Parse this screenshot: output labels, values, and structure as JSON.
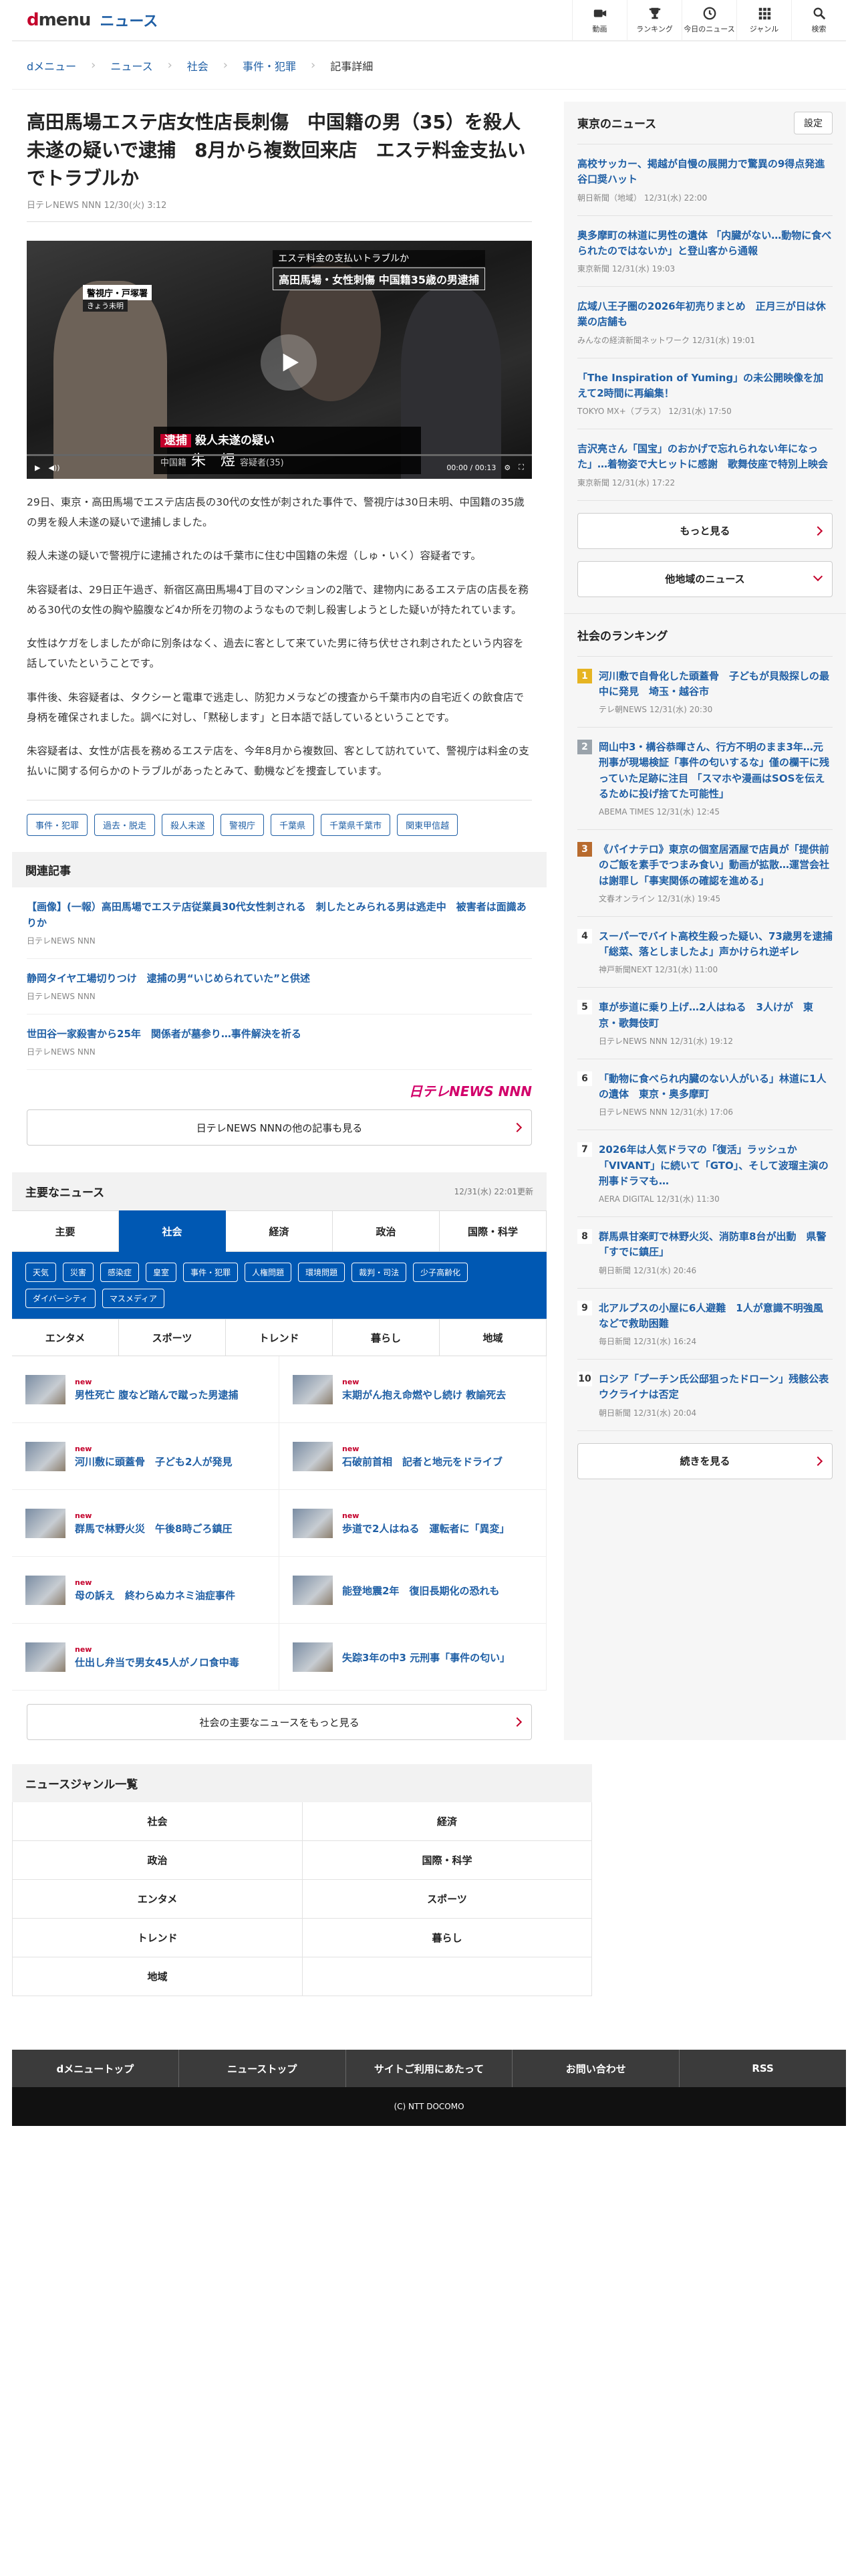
{
  "header": {
    "logo_d": "d",
    "logo_menu": "menu",
    "logo_news": "ニュース",
    "nav": [
      {
        "icon": "video-icon",
        "label": "動画"
      },
      {
        "icon": "trophy-icon",
        "label": "ランキング"
      },
      {
        "icon": "clock-icon",
        "label": "今日のニュース"
      },
      {
        "icon": "grid-icon",
        "label": "ジャンル"
      },
      {
        "icon": "search-icon",
        "label": "検索"
      }
    ]
  },
  "breadcrumb": [
    "dメニュー",
    "ニュース",
    "社会",
    "事件・犯罪",
    "記事詳細"
  ],
  "article": {
    "title": "高田馬場エステ店女性店長刺傷　中国籍の男（35）を殺人未遂の疑いで逮捕　8月から複数回来店　エステ料金支払いでトラブルか",
    "source": "日テレNEWS NNN",
    "date": "12/30(火) 3:12",
    "video": {
      "top_caption_1": "エステ料金の支払いトラブルか",
      "top_caption_2": "高田馬場・女性刺傷 中国籍35歳の男逮捕",
      "loc_1": "警視庁・戸塚署",
      "loc_2": "きょう未明",
      "cap_badge": "逮捕",
      "cap_line1": "殺人未遂の疑い",
      "cap_nat": "中国籍",
      "cap_name": "朱　煜",
      "cap_role": "容疑者(35)",
      "time": "00:00 / 00:13"
    },
    "paragraphs": [
      "29日、東京・高田馬場でエステ店店長の30代の女性が刺された事件で、警視庁は30日未明、中国籍の35歳の男を殺人未遂の疑いで逮捕しました。",
      "殺人未遂の疑いで警視庁に逮捕されたのは千葉市に住む中国籍の朱煜（しゅ・いく）容疑者です。",
      "朱容疑者は、29日正午過ぎ、新宿区高田馬場4丁目のマンションの2階で、建物内にあるエステ店の店長を務める30代の女性の胸や脇腹など4か所を刃物のようなもので刺し殺害しようとした疑いが持たれています。",
      "女性はケガをしましたが命に別条はなく、過去に客として来ていた男に待ち伏せされ刺されたという内容を話していたということです。",
      "事件後、朱容疑者は、タクシーと電車で逃走し、防犯カメラなどの捜査から千葉市内の自宅近くの飲食店で身柄を確保されました。調べに対し、「黙秘します」と日本語で話しているということです。",
      "朱容疑者は、女性が店長を務めるエステ店を、今年8月から複数回、客として訪れていて、警視庁は料金の支払いに関する何らかのトラブルがあったとみて、動機などを捜査しています。"
    ],
    "tags": [
      "事件・犯罪",
      "過去・脱走",
      "殺人未遂",
      "警視庁",
      "千葉県",
      "千葉県千葉市",
      "関東甲信越"
    ]
  },
  "related": {
    "heading": "関連記事",
    "items": [
      {
        "title": "【画像】(一報）高田馬場でエステ店従業員30代女性刺される　刺したとみられる男は逃走中　被害者は面識ありか",
        "source": "日テレNEWS NNN"
      },
      {
        "title": "静岡タイヤ工場切りつけ　逮捕の男“いじめられていた”と供述",
        "source": "日テレNEWS NNN"
      },
      {
        "title": "世田谷一家殺害から25年　関係者が墓参り…事件解決を祈る",
        "source": "日テレNEWS NNN"
      }
    ],
    "brand": "日テレNEWS NNN",
    "more_button": "日テレNEWS NNNの他の記事も見る"
  },
  "major": {
    "heading": "主要なニュース",
    "updated": "12/31(水) 22:01更新",
    "tabs": [
      "主要",
      "社会",
      "経済",
      "政治",
      "国際・科学"
    ],
    "active_tab": 1,
    "chips": [
      "天気",
      "災害",
      "感染症",
      "皇室",
      "事件・犯罪",
      "人権問題",
      "環境問題",
      "裁判・司法",
      "少子高齢化",
      "ダイバーシティ",
      "マスメディア"
    ],
    "tabs2": [
      "エンタメ",
      "スポーツ",
      "トレンド",
      "暮らし",
      "地域"
    ],
    "new_label": "new",
    "items": [
      {
        "title": "男性死亡 腹など踏んで蹴った男逮捕",
        "new": true
      },
      {
        "title": "末期がん抱え命燃やし続け 教諭死去",
        "new": true
      },
      {
        "title": "河川敷に頭蓋骨　子ども2人が発見",
        "new": true
      },
      {
        "title": "石破前首相　記者と地元をドライブ",
        "new": true
      },
      {
        "title": "群馬で林野火災　午後8時ごろ鎮圧",
        "new": true
      },
      {
        "title": "歩道で2人はねる　運転者に「異変」",
        "new": true
      },
      {
        "title": "母の訴え　終わらぬカネミ油症事件",
        "new": true
      },
      {
        "title": "能登地震2年　復旧長期化の恐れも",
        "new": false
      },
      {
        "title": "仕出し弁当で男女45人がノロ食中毒",
        "new": true
      },
      {
        "title": "失踪3年の中3 元刑事「事件の匂い」",
        "new": false
      }
    ],
    "more_button": "社会の主要なニュースをもっと見る"
  },
  "sidebar": {
    "local": {
      "heading": "東京のニュース",
      "settings": "設定",
      "items": [
        {
          "title": "高校サッカー、掲越が自慢の展開力で驚異の9得点発進　谷口奨ハット",
          "source": "朝日新聞（地域）",
          "date": "12/31(水) 22:00"
        },
        {
          "title": "奥多摩町の林道に男性の遺体 「内臓がない…動物に食べられたのではないか」と登山客から通報",
          "source": "東京新聞",
          "date": "12/31(水) 19:03"
        },
        {
          "title": "広域八王子圏の2026年初売りまとめ　正月三が日は休業の店舗も",
          "source": "みんなの経済新聞ネットワーク",
          "date": "12/31(水) 19:01"
        },
        {
          "title": "「The Inspiration of Yuming」の未公開映像を加えて2時間に再編集！",
          "source": "TOKYO MX+（プラス）",
          "date": "12/31(水) 17:50"
        },
        {
          "title": "吉沢亮さん「国宝」のおかげで忘れられない年になった」…着物姿で大ヒットに感謝　歌舞伎座で特別上映会",
          "source": "東京新聞",
          "date": "12/31(水) 17:22"
        }
      ],
      "more": "もっと見る",
      "other": "他地域のニュース"
    },
    "ranking": {
      "heading": "社会のランキング",
      "items": [
        {
          "rank": "1",
          "title": "河川敷で自骨化した頭蓋骨　子どもが貝殻探しの最中に発見　埼玉・越谷市",
          "source": "テレ朝NEWS",
          "date": "12/31(水) 20:30"
        },
        {
          "rank": "2",
          "title": "岡山中3・構谷恭暉さん、行方不明のまま3年…元刑事が現場検証「事件の匂いするな」僅の欄干に残っていた足跡に注目 「スマホや漫画はSOSを伝えるために投げ捨てた可能性」",
          "source": "ABEMA TIMES",
          "date": "12/31(水) 12:45"
        },
        {
          "rank": "3",
          "title": "《パイナテロ》東京の個室居酒屋で店員が「提供前のご飯を素手でつまみ食い」動画が拡散…運営会社は謝罪し「事実関係の確認を進める」",
          "source": "文春オンライン",
          "date": "12/31(水) 19:45"
        },
        {
          "rank": "4",
          "title": "スーパーでバイト高校生殺った疑い、73歳男を逮捕 「総菜、落としましたよ」声かけられ逆ギレ",
          "source": "神戸新聞NEXT",
          "date": "12/31(水) 11:00"
        },
        {
          "rank": "5",
          "title": "車が歩道に乗り上げ…2人はねる　3人けが　東京・歌舞伎町",
          "source": "日テレNEWS NNN",
          "date": "12/31(水) 19:12"
        },
        {
          "rank": "6",
          "title": "「動物に食べられ内臓のない人がいる」林道に1人の遺体　東京・奥多摩町",
          "source": "日テレNEWS NNN",
          "date": "12/31(水) 17:06"
        },
        {
          "rank": "7",
          "title": "2026年は人気ドラマの「復活」ラッシュか 「VIVANT」に続いて「GTO」、そして波瑠主演の刑事ドラマも…",
          "source": "AERA DIGITAL",
          "date": "12/31(水) 11:30"
        },
        {
          "rank": "8",
          "title": "群馬県甘楽町で林野火災、消防車8台が出動　県警「すでに鎮圧」",
          "source": "朝日新聞",
          "date": "12/31(水) 20:46"
        },
        {
          "rank": "9",
          "title": "北アルプスの小屋に6人避難　1人が意識不明強風などで救助困難",
          "source": "毎日新聞",
          "date": "12/31(水) 16:24"
        },
        {
          "rank": "10",
          "title": "ロシア「プーチン氏公邸狙ったドローン」残骸公表　ウクライナは否定",
          "source": "朝日新聞",
          "date": "12/31(水) 20:04"
        }
      ],
      "more": "続きを見る"
    }
  },
  "genres": {
    "heading": "ニュースジャンル一覧",
    "items": [
      "社会",
      "経済",
      "政治",
      "国際・科学",
      "エンタメ",
      "スポーツ",
      "トレンド",
      "暮らし",
      "地域"
    ]
  },
  "footer": {
    "links": [
      "dメニュートップ",
      "ニューストップ",
      "サイトご利用にあたって",
      "お問い合わせ",
      "RSS"
    ],
    "copyright": "(C) NTT DOCOMO"
  },
  "colors": {
    "brand_red": "#c4002b",
    "link_blue": "#1f5fa5",
    "tab_blue": "#0058b3"
  }
}
